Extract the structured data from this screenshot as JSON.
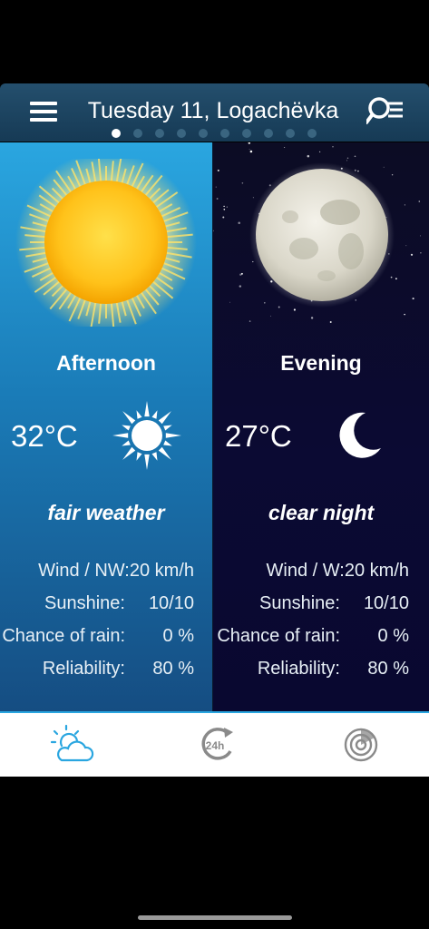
{
  "header": {
    "title": "Tuesday 11, Logachëvka",
    "menu_icon": "hamburger-menu-icon",
    "search_icon": "search-list-icon",
    "page_count": 10,
    "active_page": 0
  },
  "afternoon": {
    "title": "Afternoon",
    "temperature": "32°C",
    "condition": "fair weather",
    "details": [
      {
        "label": "Wind / NW:20 km/h",
        "value": ""
      },
      {
        "label": "Sunshine:",
        "value": "10/10"
      },
      {
        "label": "Chance of rain:",
        "value": "0 %"
      },
      {
        "label": "Reliability:",
        "value": "80 %"
      }
    ],
    "big_icon": "sun-icon",
    "condition_icon": "sun-icon"
  },
  "evening": {
    "title": "Evening",
    "temperature": "27°C",
    "condition": "clear night",
    "details": [
      {
        "label": "Wind / W:20 km/h",
        "value": ""
      },
      {
        "label": "Sunshine:",
        "value": "10/10"
      },
      {
        "label": "Chance of rain:",
        "value": "0 %"
      },
      {
        "label": "Reliability:",
        "value": "80 %"
      }
    ],
    "big_icon": "full-moon-icon",
    "condition_icon": "crescent-moon-icon"
  },
  "tabs": [
    {
      "name": "tab-current-weather",
      "icon": "cloud-sun-icon",
      "active": true
    },
    {
      "name": "tab-24h-forecast",
      "icon": "24h-clock-icon",
      "active": false
    },
    {
      "name": "tab-radar",
      "icon": "radar-icon",
      "active": false
    }
  ],
  "colors": {
    "header": "#1c4560",
    "afternoon_bg": "#1a7bb7",
    "evening_bg": "#0b0a33",
    "accent": "#2aa6e0"
  }
}
